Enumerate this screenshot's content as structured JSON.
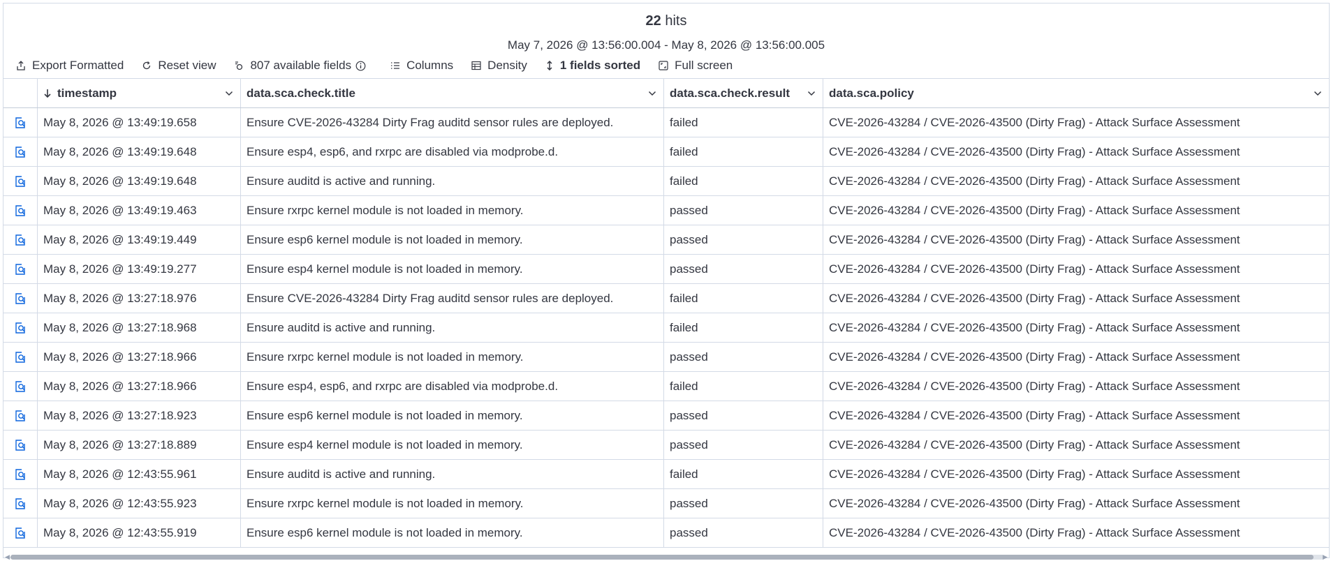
{
  "header": {
    "hits_count": "22",
    "hits_label": "hits",
    "time_range": "May 7, 2026 @ 13:56:00.004 - May 8, 2026 @ 13:56:00.005"
  },
  "toolbar": {
    "export": "Export Formatted",
    "reset": "Reset view",
    "fields": "807 available fields",
    "columns": "Columns",
    "density": "Density",
    "sorted": "1 fields sorted",
    "fullscreen": "Full screen"
  },
  "table": {
    "columns": [
      "timestamp",
      "data.sca.check.title",
      "data.sca.check.result",
      "data.sca.policy"
    ],
    "rows": [
      [
        "May 8, 2026 @ 13:49:19.658",
        "Ensure CVE-2026-43284 Dirty Frag auditd sensor rules are deployed.",
        "failed",
        "CVE-2026-43284 / CVE-2026-43500 (Dirty Frag) - Attack Surface Assessment"
      ],
      [
        "May 8, 2026 @ 13:49:19.648",
        "Ensure esp4, esp6, and rxrpc are disabled via modprobe.d.",
        "failed",
        "CVE-2026-43284 / CVE-2026-43500 (Dirty Frag) - Attack Surface Assessment"
      ],
      [
        "May 8, 2026 @ 13:49:19.648",
        "Ensure auditd is active and running.",
        "failed",
        "CVE-2026-43284 / CVE-2026-43500 (Dirty Frag) - Attack Surface Assessment"
      ],
      [
        "May 8, 2026 @ 13:49:19.463",
        "Ensure rxrpc kernel module is not loaded in memory.",
        "passed",
        "CVE-2026-43284 / CVE-2026-43500 (Dirty Frag) - Attack Surface Assessment"
      ],
      [
        "May 8, 2026 @ 13:49:19.449",
        "Ensure esp6 kernel module is not loaded in memory.",
        "passed",
        "CVE-2026-43284 / CVE-2026-43500 (Dirty Frag) - Attack Surface Assessment"
      ],
      [
        "May 8, 2026 @ 13:49:19.277",
        "Ensure esp4 kernel module is not loaded in memory.",
        "passed",
        "CVE-2026-43284 / CVE-2026-43500 (Dirty Frag) - Attack Surface Assessment"
      ],
      [
        "May 8, 2026 @ 13:27:18.976",
        "Ensure CVE-2026-43284 Dirty Frag auditd sensor rules are deployed.",
        "failed",
        "CVE-2026-43284 / CVE-2026-43500 (Dirty Frag) - Attack Surface Assessment"
      ],
      [
        "May 8, 2026 @ 13:27:18.968",
        "Ensure auditd is active and running.",
        "failed",
        "CVE-2026-43284 / CVE-2026-43500 (Dirty Frag) - Attack Surface Assessment"
      ],
      [
        "May 8, 2026 @ 13:27:18.966",
        "Ensure rxrpc kernel module is not loaded in memory.",
        "passed",
        "CVE-2026-43284 / CVE-2026-43500 (Dirty Frag) - Attack Surface Assessment"
      ],
      [
        "May 8, 2026 @ 13:27:18.966",
        "Ensure esp4, esp6, and rxrpc are disabled via modprobe.d.",
        "failed",
        "CVE-2026-43284 / CVE-2026-43500 (Dirty Frag) - Attack Surface Assessment"
      ],
      [
        "May 8, 2026 @ 13:27:18.923",
        "Ensure esp6 kernel module is not loaded in memory.",
        "passed",
        "CVE-2026-43284 / CVE-2026-43500 (Dirty Frag) - Attack Surface Assessment"
      ],
      [
        "May 8, 2026 @ 13:27:18.889",
        "Ensure esp4 kernel module is not loaded in memory.",
        "passed",
        "CVE-2026-43284 / CVE-2026-43500 (Dirty Frag) - Attack Surface Assessment"
      ],
      [
        "May 8, 2026 @ 12:43:55.961",
        "Ensure auditd is active and running.",
        "failed",
        "CVE-2026-43284 / CVE-2026-43500 (Dirty Frag) - Attack Surface Assessment"
      ],
      [
        "May 8, 2026 @ 12:43:55.923",
        "Ensure rxrpc kernel module is not loaded in memory.",
        "passed",
        "CVE-2026-43284 / CVE-2026-43500 (Dirty Frag) - Attack Surface Assessment"
      ],
      [
        "May 8, 2026 @ 12:43:55.919",
        "Ensure esp6 kernel module is not loaded in memory.",
        "passed",
        "CVE-2026-43284 / CVE-2026-43500 (Dirty Frag) - Attack Surface Assessment"
      ]
    ]
  },
  "icons": {
    "row_action": "inspect-document-icon",
    "sort": "arrow-down-icon",
    "column_menu": "chevron-down-icon"
  },
  "colors": {
    "accent": "#0b64dd",
    "border": "#d3dae6",
    "text": "#343741"
  }
}
